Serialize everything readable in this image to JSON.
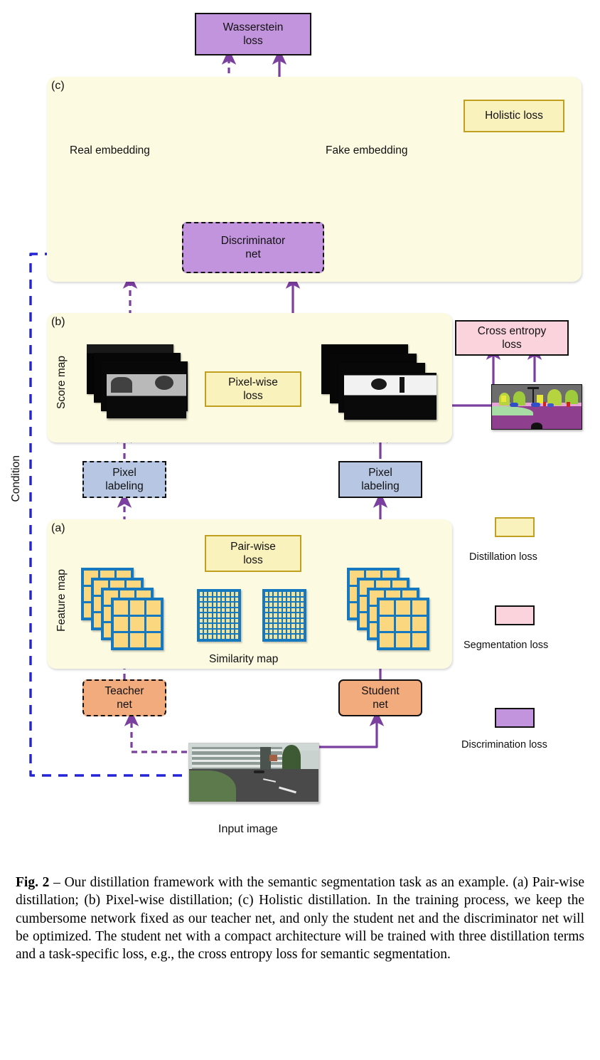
{
  "figure": {
    "panels": [
      {
        "tag": "(a)",
        "name": "pair-wise-distillation"
      },
      {
        "tag": "(b)",
        "name": "pixel-wise-distillation"
      },
      {
        "tag": "(c)",
        "name": "holistic-distillation"
      }
    ],
    "boxes": {
      "wasserstein_loss": "Wasserstein\nloss",
      "holistic_loss": "Holistic loss",
      "discriminator_net": "Discriminator\nnet",
      "cross_entropy_loss": "Cross entropy\nloss",
      "pixel_wise_loss": "Pixel-wise\nloss",
      "pair_wise_loss": "Pair-wise\nloss",
      "pixel_labeling_teacher": "Pixel\nlabeling",
      "pixel_labeling_student": "Pixel\nlabeling",
      "teacher_net": "Teacher\nnet",
      "student_net": "Student\nnet"
    },
    "labels": {
      "real_embedding": "Real embedding",
      "fake_embedding": "Fake embedding",
      "condition": "Condition",
      "score_map": "Score map",
      "feature_map": "Feature map",
      "similarity_map": "Similarity map",
      "input_image": "Input image"
    },
    "legend": [
      {
        "label": "Distillation loss",
        "color": "#faf2bd",
        "border": "#c2a01f"
      },
      {
        "label": "Segmentation loss",
        "color": "#fad3dd",
        "border": "#111111"
      },
      {
        "label": "Discrimination loss",
        "color": "#c294dd",
        "border": "#111111"
      }
    ],
    "colors": {
      "distillation": "#faf2bd",
      "distillation_border": "#c2a01f",
      "segmentation": "#fad3dd",
      "discrimination": "#c294dd",
      "net_box": "#f2ab7c",
      "labeling_box": "#b7c7e3",
      "panel_bg": "#fcfae0",
      "arrow_purple": "#7b3fa0",
      "condition_blue": "#2323d8",
      "grid_blue": "#1678be",
      "grid_cell": "#fbd87f"
    }
  },
  "caption": {
    "prefix": "Fig. 2",
    "text": " – Our distillation framework with the semantic segmentation task as an example. (a) Pair-wise distillation; (b) Pixel-wise distillation; (c) Holistic distillation. In the training process, we keep the cumbersome network fixed as our teacher net, and only the student net and the discriminator net will be optimized. The student net with a compact architecture will be trained with three distillation terms and a task-specific loss, e.g., the cross entropy loss for semantic segmentation."
  }
}
